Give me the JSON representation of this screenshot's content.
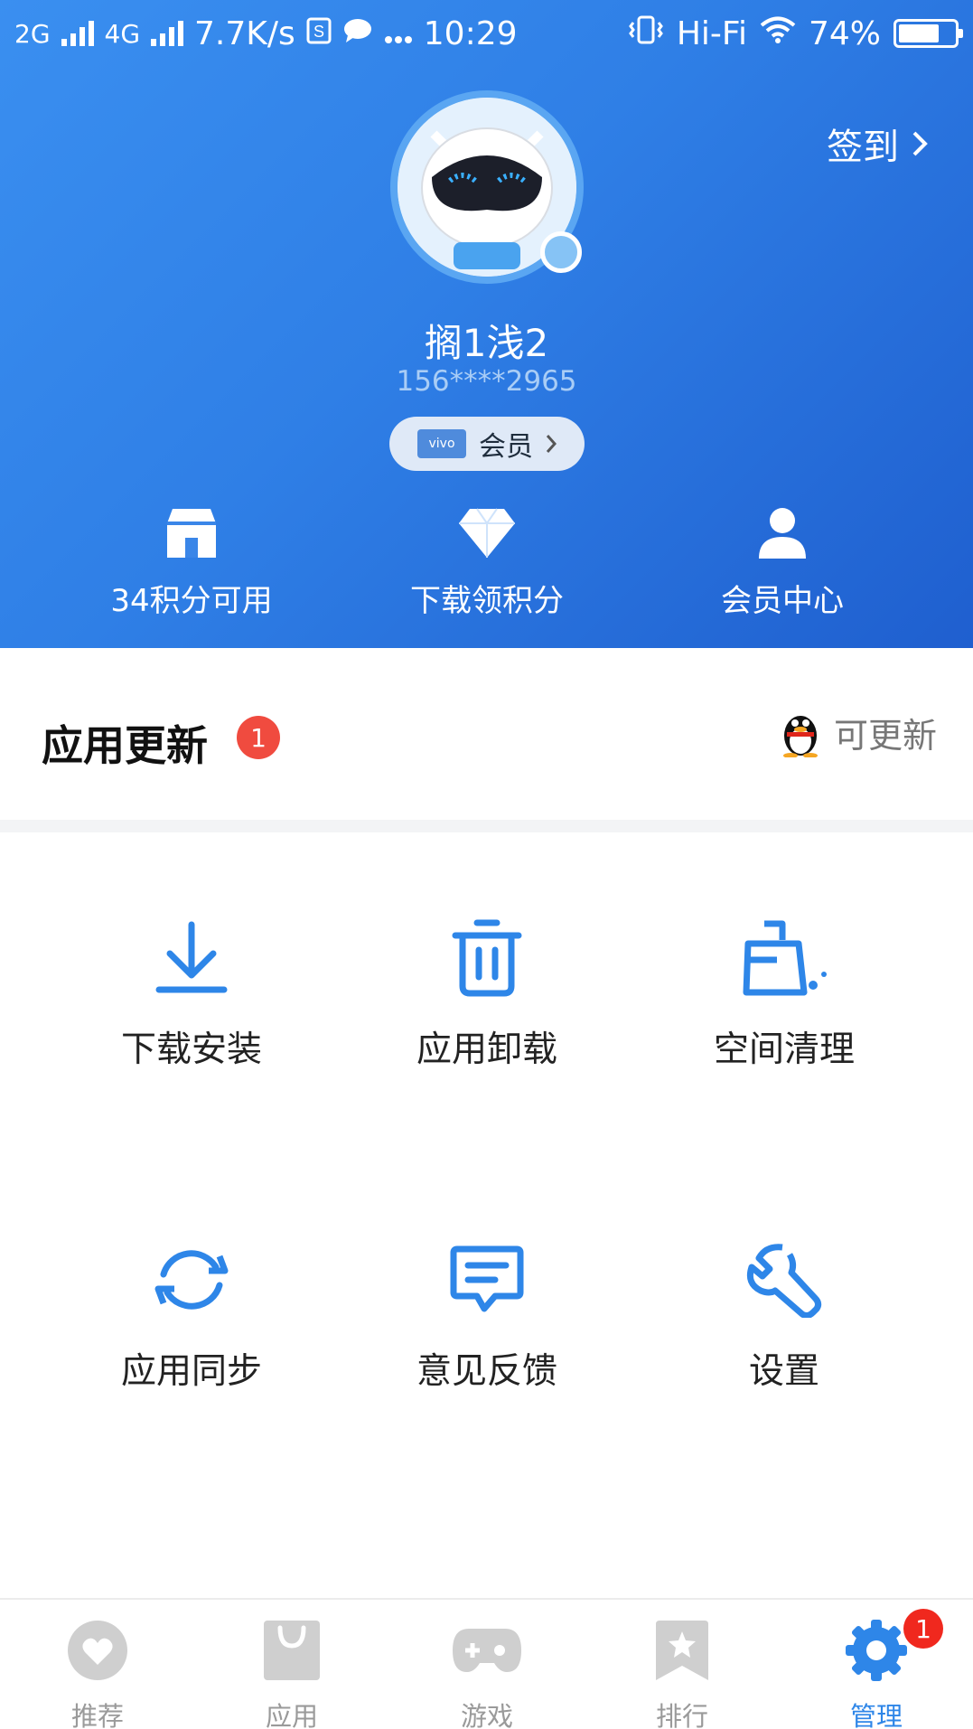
{
  "status_bar": {
    "network1": "2G",
    "network2": "4G",
    "speed": "7.7K/s",
    "time": "10:29",
    "hifi": "Hi-Fi",
    "battery": "74%",
    "battery_level": 0.74
  },
  "header": {
    "checkin_label": "签到",
    "username": "搁1浅2",
    "phone": "156****2965",
    "vip_brand": "vivo",
    "vip_label": "会员",
    "quick_actions": [
      {
        "label": "34积分可用",
        "icon": "store-icon"
      },
      {
        "label": "下载领积分",
        "icon": "diamond-icon"
      },
      {
        "label": "会员中心",
        "icon": "user-icon"
      }
    ]
  },
  "update": {
    "title": "应用更新",
    "count": "1",
    "right_label": "可更新",
    "right_icon": "qq-penguin-icon"
  },
  "tools": [
    {
      "label": "下载安装",
      "icon": "download-icon"
    },
    {
      "label": "应用卸载",
      "icon": "trash-icon"
    },
    {
      "label": "空间清理",
      "icon": "broom-icon"
    },
    {
      "label": "应用同步",
      "icon": "sync-icon"
    },
    {
      "label": "意见反馈",
      "icon": "feedback-icon"
    },
    {
      "label": "设置",
      "icon": "wrench-icon"
    }
  ],
  "bottom_nav": {
    "items": [
      {
        "label": "推荐",
        "icon": "heart-icon"
      },
      {
        "label": "应用",
        "icon": "bag-icon"
      },
      {
        "label": "游戏",
        "icon": "gamepad-icon"
      },
      {
        "label": "排行",
        "icon": "rank-bookmark-icon"
      },
      {
        "label": "管理",
        "icon": "gear-icon",
        "active": true
      }
    ],
    "manage_badge": "1"
  },
  "colors": {
    "accent": "#2e86e8",
    "badge_red": "#f04b3f",
    "header_blue": "#2f7fe6"
  }
}
